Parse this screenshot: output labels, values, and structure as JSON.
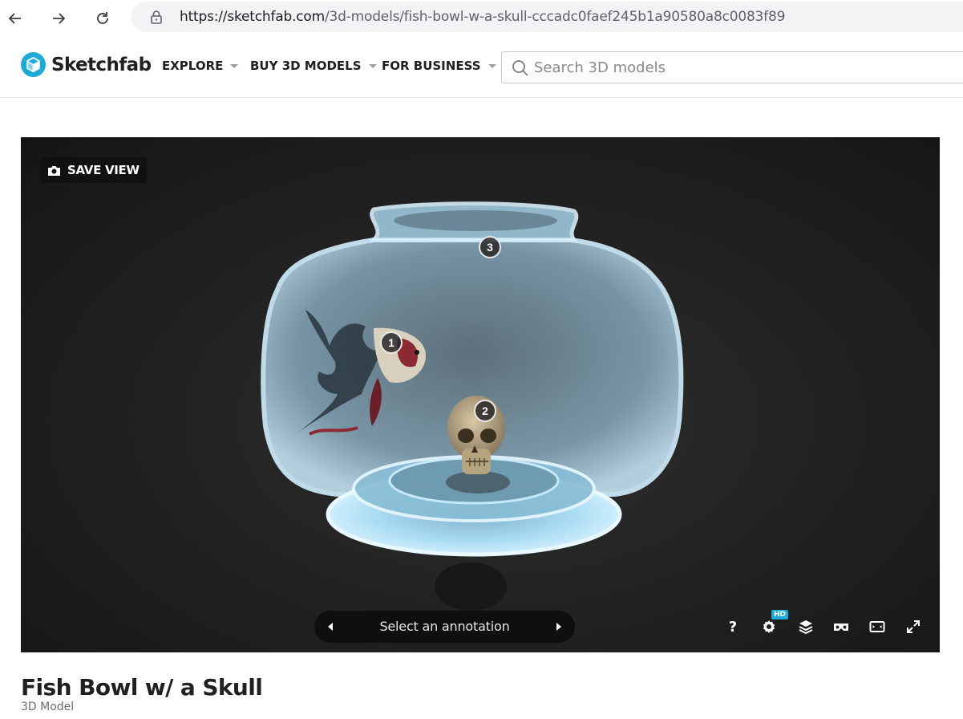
{
  "browser": {
    "url_host": "https://sketchfab.com",
    "url_path": "/3d-models/fish-bowl-w-a-skull-cccadc0faef245b1a90580a8c0083f89",
    "back_icon": "arrow-left-icon",
    "forward_icon": "arrow-right-icon",
    "reload_icon": "reload-icon",
    "lock_icon": "lock-icon"
  },
  "header": {
    "logo_text": "Sketchfab",
    "brand_color": "#1caad9",
    "menu": [
      {
        "label": "EXPLORE"
      },
      {
        "label": "BUY 3D MODELS"
      },
      {
        "label": "FOR BUSINESS"
      }
    ],
    "search_placeholder": "Search 3D models"
  },
  "viewer": {
    "save_view_label": "SAVE VIEW",
    "hotspots": [
      {
        "number": "1"
      },
      {
        "number": "2"
      },
      {
        "number": "3"
      }
    ],
    "annotation_label": "Select an annotation",
    "help_label": "?",
    "hd_badge": "HD"
  },
  "model": {
    "title": "Fish Bowl w/ a Skull",
    "subtitle": "3D Model"
  }
}
